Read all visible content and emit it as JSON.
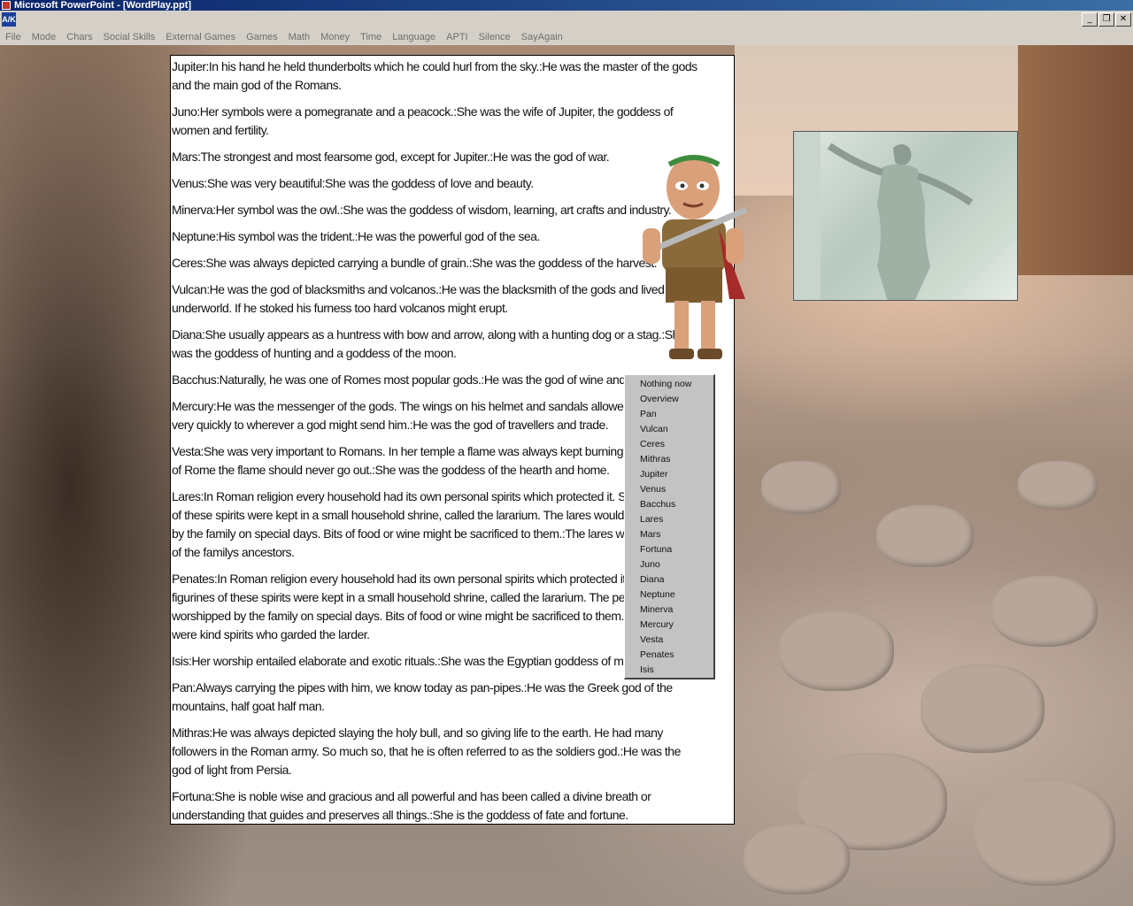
{
  "window": {
    "title": "Microsoft PowerPoint - [WordPlay.ppt]"
  },
  "doc_icon_label": "A/K",
  "mdi_buttons": {
    "minimize": "_",
    "restore": "❐",
    "close": "✕"
  },
  "menu": [
    "File",
    "Mode",
    "Chars",
    "Social Skills",
    "External Games",
    "Games",
    "Math",
    "Money",
    "Time",
    "Language",
    "APTI",
    "Silence",
    "SayAgain"
  ],
  "entries": [
    "Jupiter:In his hand he held thunderbolts which he could hurl from the sky.:He was the master of the gods and the main god of the Romans.",
    "Juno:Her symbols were a pomegranate and a peacock.:She was the wife of Jupiter, the goddess of women and fertility.",
    "Mars:The strongest and most fearsome god, except for Jupiter.:He was the god of war.",
    "Venus:She was very beautiful:She was the goddess of love and beauty.",
    "Minerva:Her symbol was the owl.:She was the goddess of wisdom, learning, art crafts and industry.",
    "Neptune:His symbol was the trident.:He was the powerful god of the sea.",
    "Ceres:She was always depicted carrying a bundle of grain.:She was the goddess of the harvest.",
    "Vulcan:He was the god of blacksmiths and volcanos.:He was the blacksmith of the gods and lived in the underworld. If he stoked his furness too hard volcanos might erupt.",
    "Diana:She usually appears as a huntress with bow and arrow, along with a hunting dog or a stag.:She was the goddess of hunting and a goddess of the moon.",
    "Bacchus:Naturally, he was one of Romes most popular gods.:He was the god of wine and partying.",
    "Mercury:He was the messenger of the gods. The wings on his helmet and sandals allowed him to travel very quickly to wherever a god might send him.:He was the god of travellers and trade.",
    "Vesta:She was very important to Romans. In her temple a flame was always kept burning. In the hearth of Rome the flame should never go out.:She was the goddess of the hearth and home.",
    "Lares:In Roman religion every household had its own personal spirits which protected it. Small figurines of these spirits were kept in a small household shrine, called the lararium. The lares would be worshipped by the family on special days. Bits of food or wine might be sacrificed to them.:The lares were the spirits of the familys ancestors.",
    "Penates:In Roman religion every household had its own personal spirits which protected it. Small figurines of these spirits were kept in a small household shrine, called the lararium. The penates would be worshipped by the family on special days. Bits of food or wine might be sacrificed to them.:The penates were kind spirits who garded the larder.",
    "Isis:Her worship entailed elaborate and exotic rituals.:She was the Egyptian goddess of magic.",
    "Pan:Always carrying the pipes with him, we know today as pan-pipes.:He was the Greek god of the mountains, half goat half man.",
    "Mithras:He was always depicted slaying the holy bull, and so giving life to the earth. He had many followers in the Roman army. So much so, that he is often referred to as the soldiers god.:He was the god of light from Persia.",
    "Fortuna:She is noble wise and gracious and all powerful and has been called a divine breath or understanding that guides and preserves all things.:She is the goddess of fate and fortune."
  ],
  "popup_list": [
    "Nothing now",
    "Overview",
    "Pan",
    "Vulcan",
    "Ceres",
    "Mithras",
    "Jupiter",
    "Venus",
    "Bacchus",
    "Lares",
    "Mars",
    "Fortuna",
    "Juno",
    "Diana",
    "Neptune",
    "Minerva",
    "Mercury",
    "Vesta",
    "Penates",
    "Isis"
  ]
}
